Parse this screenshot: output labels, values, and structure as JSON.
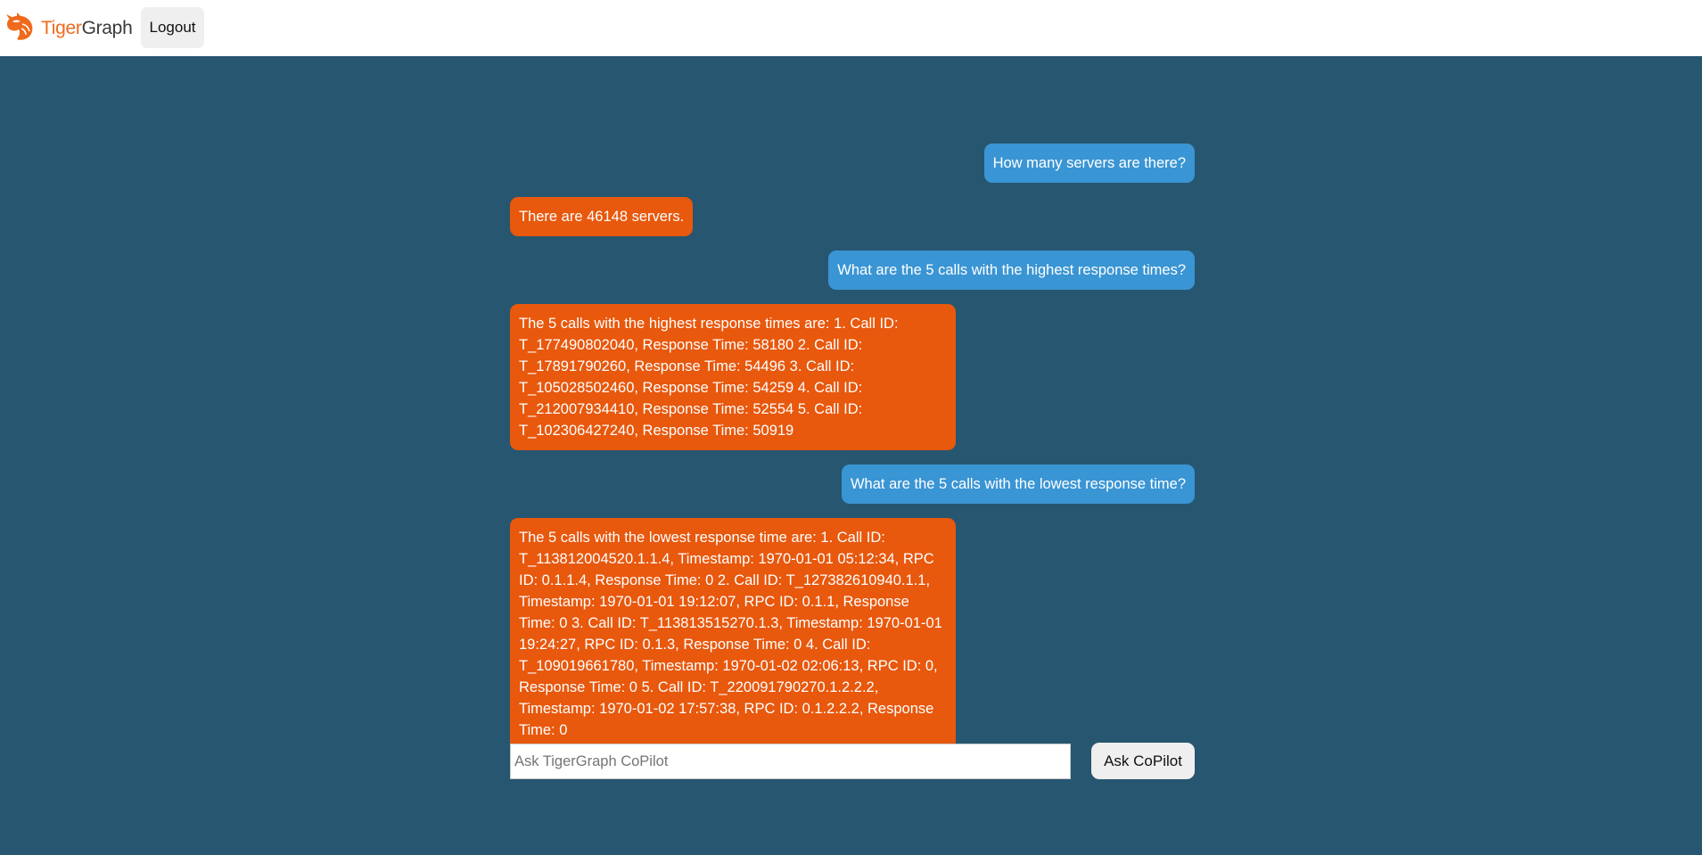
{
  "header": {
    "logo_icon": "tiger-head-icon",
    "logo_text_part1": "Tiger",
    "logo_text_part2": "Graph",
    "logout_label": "Logout"
  },
  "colors": {
    "page_bg": "#275670",
    "user_bubble": "#3a95d4",
    "bot_bubble": "#e8580d",
    "brand_orange": "#ef6a1d"
  },
  "messages": [
    {
      "role": "user",
      "text": "How many servers are there?"
    },
    {
      "role": "bot",
      "text": "There are 46148 servers."
    },
    {
      "role": "user",
      "text": "What are the 5 calls with the highest response times?"
    },
    {
      "role": "bot",
      "text": "The 5 calls with the highest response times are: 1. Call ID: T_177490802040, Response Time: 58180 2. Call ID: T_17891790260, Response Time: 54496 3. Call ID: T_105028502460, Response Time: 54259 4. Call ID: T_212007934410, Response Time: 52554 5. Call ID: T_102306427240, Response Time: 50919"
    },
    {
      "role": "user",
      "text": "What are the 5 calls with the lowest response time?"
    },
    {
      "role": "bot",
      "text": "The 5 calls with the lowest response time are: 1. Call ID: T_113812004520.1.1.4, Timestamp: 1970-01-01 05:12:34, RPC ID: 0.1.1.4, Response Time: 0 2. Call ID: T_127382610940.1.1, Timestamp: 1970-01-01 19:12:07, RPC ID: 0.1.1, Response Time: 0 3. Call ID: T_113813515270.1.3, Timestamp: 1970-01-01 19:24:27, RPC ID: 0.1.3, Response Time: 0 4. Call ID: T_109019661780, Timestamp: 1970-01-02 02:06:13, RPC ID: 0, Response Time: 0 5. Call ID: T_220091790270.1.2.2.2, Timestamp: 1970-01-02 17:57:38, RPC ID: 0.1.2.2.2, Response Time: 0"
    }
  ],
  "composer": {
    "placeholder": "Ask TigerGraph CoPilot",
    "value": "",
    "submit_label": "Ask CoPilot"
  }
}
